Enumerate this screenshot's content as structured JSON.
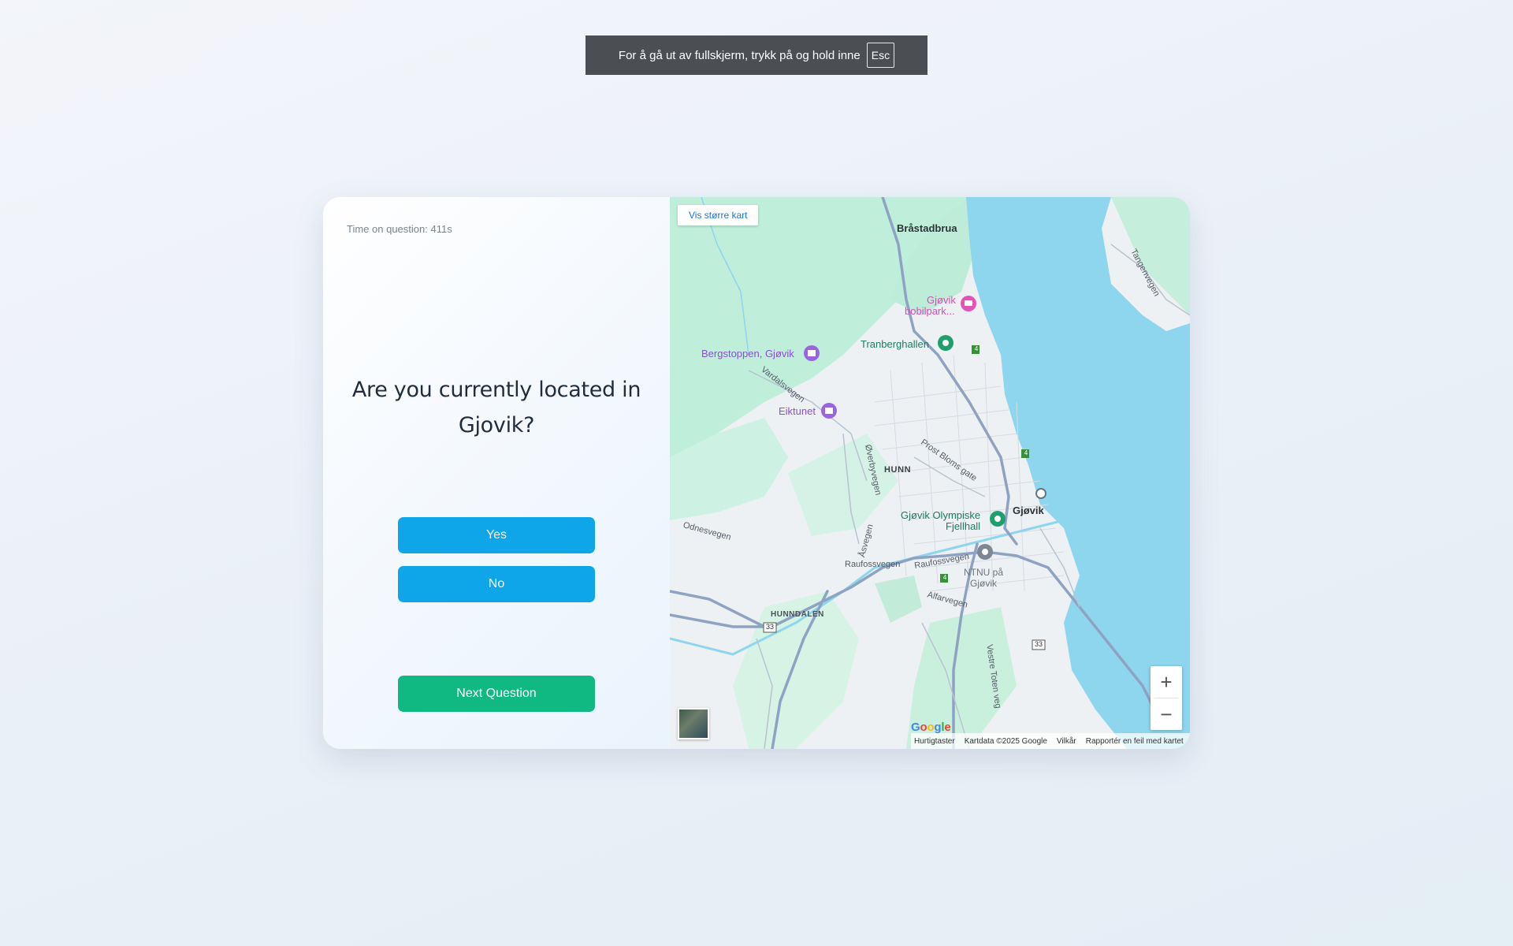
{
  "fullscreen_banner": {
    "text": "For å gå ut av fullskjerm, trykk på og hold inne",
    "key": "Esc"
  },
  "quiz": {
    "timer": "Time on question: 411s",
    "question": "Are you currently located in Gjovik?",
    "yes_label": "Yes",
    "no_label": "No",
    "next_label": "Next Question",
    "colors": {
      "answer_button": "#0ea5e9",
      "next_button": "#10b981"
    }
  },
  "map": {
    "larger_map_link": "Vis større kart",
    "places": {
      "brastadbrua": "Bråstadbrua",
      "bobilpark_line1": "Gjøvik",
      "bobilpark_line2": "bobilpark...",
      "tranberghallen": "Tranberghallen",
      "bergstoppen": "Bergstoppen, Gjøvik",
      "eiktunet": "Eiktunet",
      "hunn": "HUNN",
      "gjovik": "Gjøvik",
      "olympiske_line1": "Gjøvik Olympiske",
      "olympiske_line2": "Fjellhall",
      "ntnu_line1": "NTNU på",
      "ntnu_line2": "Gjøvik",
      "hunndalen": "HUNNDALEN"
    },
    "roads": {
      "vardalsvegen": "Vardalsvegen",
      "overbyvegen": "Øverbyvegen",
      "prost_bloms": "Prost Bloms gate",
      "odnesvegen": "Odnesvegen",
      "asvegen": "Åsvegen",
      "raufossvegen_1": "Raufossvegen",
      "raufossvegen_2": "Raufossvegen",
      "alfarvegen": "Alfarvegen",
      "vestre_toten": "Vestre Toten veg",
      "tangen": "Tangenvegen"
    },
    "road_numbers": {
      "r4a": "4",
      "r4b": "4",
      "r4c": "4",
      "r33a": "33",
      "r33b": "33"
    },
    "logo": "Google",
    "attribution": {
      "shortcuts": "Hurtigtaster",
      "data": "Kartdata ©2025 Google",
      "terms": "Vilkår",
      "report": "Rapportér en feil med kartet"
    },
    "zoom_in": "+",
    "zoom_out": "−"
  }
}
